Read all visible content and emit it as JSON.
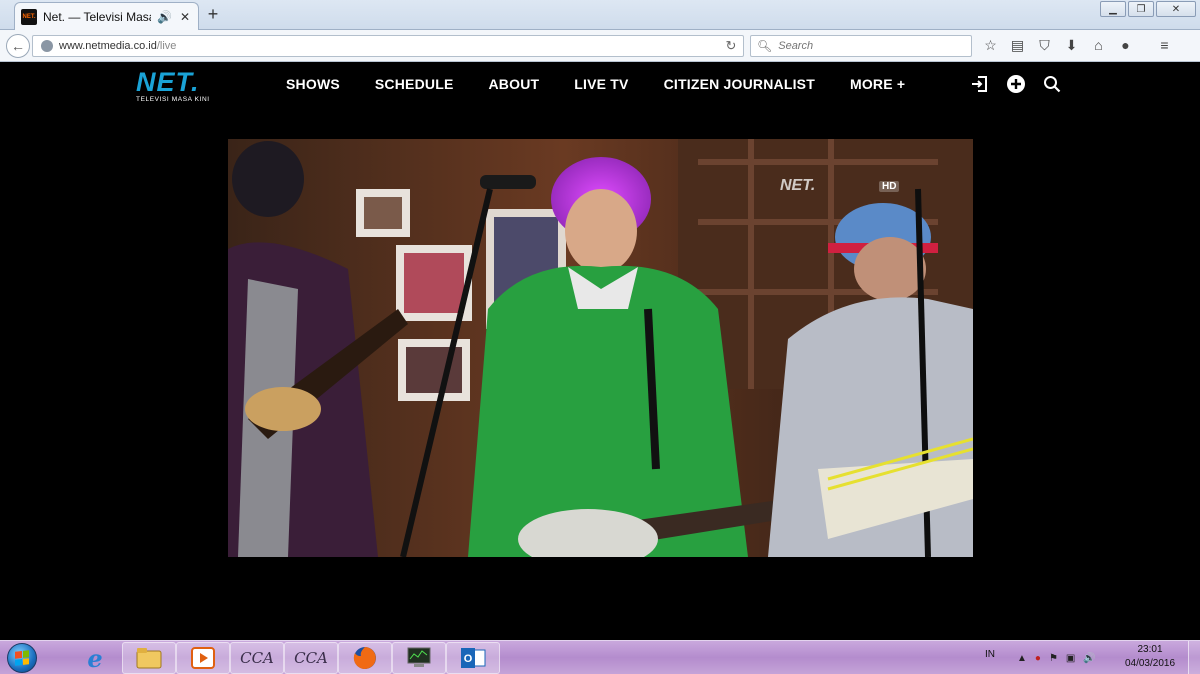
{
  "browser": {
    "tab_title": "Net. — Televisi Masa Ki...",
    "tab_favicon_text": "NET.",
    "url_domain": "www.netmedia.co.id",
    "url_path": "/live",
    "search_placeholder": "Search",
    "toolbar_icons": [
      "bookmark-star-icon",
      "reading-list-icon",
      "pocket-icon",
      "download-icon",
      "home-icon",
      "chat-icon",
      "menu-icon"
    ]
  },
  "site": {
    "logo_text": "NET",
    "logo_tagline": "TELEVISI MASA KINI",
    "nav": [
      "SHOWS",
      "SCHEDULE",
      "ABOUT",
      "LIVE TV",
      "CITIZEN JOURNALIST",
      "MORE +"
    ],
    "accent_color": "#1aa3d6"
  },
  "player": {
    "watermark": "NET.",
    "quality_badge": "HD"
  },
  "taskbar": {
    "apps": [
      "internet-explorer",
      "file-explorer",
      "media-player",
      "cca-app-1",
      "cca-app-2",
      "firefox",
      "task-manager",
      "outlook"
    ],
    "cca_label_1": "CCA",
    "cca_label_2": "CCA",
    "language": "IN",
    "time": "23:01",
    "date": "04/03/2016"
  }
}
